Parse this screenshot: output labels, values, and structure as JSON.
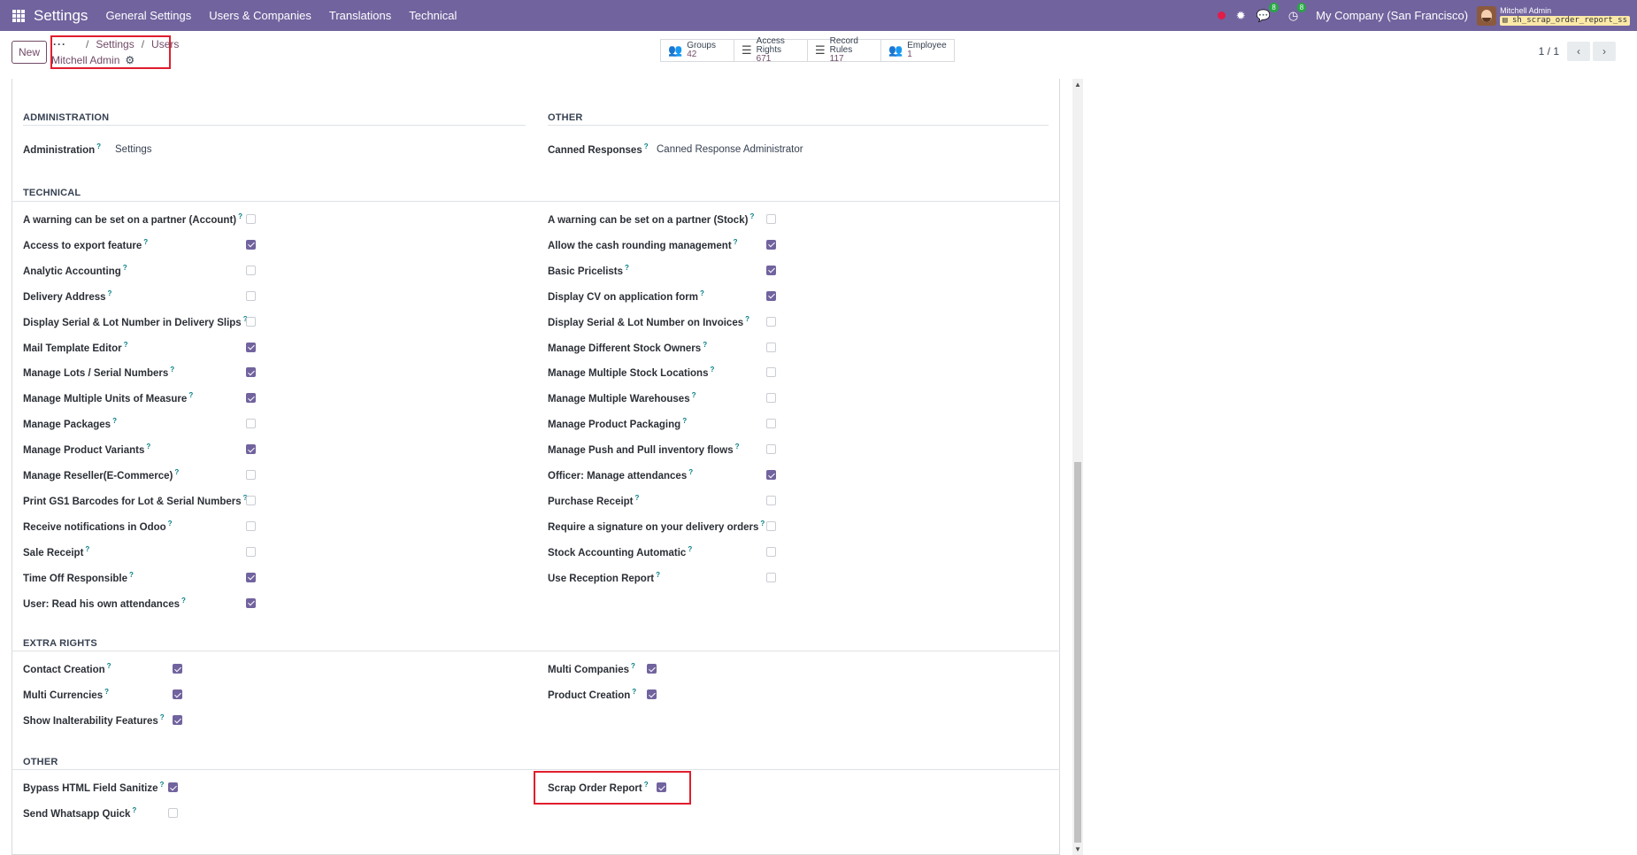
{
  "navbar": {
    "brand": "Settings",
    "menu": [
      "General Settings",
      "Users & Companies",
      "Translations",
      "Technical"
    ],
    "chat_badge": "8",
    "activity_badge": "8",
    "company": "My Company (San Francisco)",
    "user_name": "Mitchell Admin",
    "db_name": "sh_scrap_order_report_ss",
    "accent_color": "#71639e"
  },
  "control": {
    "new_label": "New",
    "breadcrumb": [
      "Settings",
      "Users"
    ],
    "record_title": "Mitchell Admin",
    "smart_buttons": [
      {
        "label": "Groups",
        "count": "42",
        "icon": "users-icon"
      },
      {
        "label": "Access Rights",
        "count": "671",
        "icon": "list-icon"
      },
      {
        "label": "Record Rules",
        "count": "117",
        "icon": "list-icon"
      },
      {
        "label": "Employee",
        "count": "1",
        "icon": "users-icon"
      }
    ],
    "pager": "1 / 1"
  },
  "form": {
    "administration": {
      "title": "ADMINISTRATION",
      "label": "Administration",
      "value": "Settings"
    },
    "other_top": {
      "title": "OTHER",
      "label": "Canned Responses",
      "value": "Canned Response Administrator"
    },
    "technical": {
      "title": "TECHNICAL",
      "left": [
        {
          "label": "A warning can be set on a partner (Account)",
          "checked": false
        },
        {
          "label": "Access to export feature",
          "checked": true
        },
        {
          "label": "Analytic Accounting",
          "checked": false
        },
        {
          "label": "Delivery Address",
          "checked": false
        },
        {
          "label": "Display Serial & Lot Number in Delivery Slips",
          "checked": false
        },
        {
          "label": "Mail Template Editor",
          "checked": true
        },
        {
          "label": "Manage Lots / Serial Numbers",
          "checked": true
        },
        {
          "label": "Manage Multiple Units of Measure",
          "checked": true
        },
        {
          "label": "Manage Packages",
          "checked": false
        },
        {
          "label": "Manage Product Variants",
          "checked": true
        },
        {
          "label": "Manage Reseller(E-Commerce)",
          "checked": false
        },
        {
          "label": "Print GS1 Barcodes for Lot & Serial Numbers",
          "checked": false
        },
        {
          "label": "Receive notifications in Odoo",
          "checked": false
        },
        {
          "label": "Sale Receipt",
          "checked": false
        },
        {
          "label": "Time Off Responsible",
          "checked": true
        },
        {
          "label": "User: Read his own attendances",
          "checked": true
        }
      ],
      "right": [
        {
          "label": "A warning can be set on a partner (Stock)",
          "checked": false
        },
        {
          "label": "Allow the cash rounding management",
          "checked": true
        },
        {
          "label": "Basic Pricelists",
          "checked": true
        },
        {
          "label": "Display CV on application form",
          "checked": true
        },
        {
          "label": "Display Serial & Lot Number on Invoices",
          "checked": false
        },
        {
          "label": "Manage Different Stock Owners",
          "checked": false
        },
        {
          "label": "Manage Multiple Stock Locations",
          "checked": false
        },
        {
          "label": "Manage Multiple Warehouses",
          "checked": false
        },
        {
          "label": "Manage Product Packaging",
          "checked": false
        },
        {
          "label": "Manage Push and Pull inventory flows",
          "checked": false
        },
        {
          "label": "Officer: Manage attendances",
          "checked": true
        },
        {
          "label": "Purchase Receipt",
          "checked": false
        },
        {
          "label": "Require a signature on your delivery orders",
          "checked": false
        },
        {
          "label": "Stock Accounting Automatic",
          "checked": false
        },
        {
          "label": "Use Reception Report",
          "checked": false
        }
      ]
    },
    "extra_rights": {
      "title": "EXTRA RIGHTS",
      "left": [
        {
          "label": "Contact Creation",
          "checked": true
        },
        {
          "label": "Multi Currencies",
          "checked": true
        },
        {
          "label": "Show Inalterability Features",
          "checked": true
        }
      ],
      "right": [
        {
          "label": "Multi Companies",
          "checked": true
        },
        {
          "label": "Product Creation",
          "checked": true
        }
      ]
    },
    "other_bottom": {
      "title": "OTHER",
      "left": [
        {
          "label": "Bypass HTML Field Sanitize",
          "checked": true
        },
        {
          "label": "Send Whatsapp Quick",
          "checked": false
        }
      ],
      "right": [
        {
          "label": "Scrap Order Report",
          "checked": true
        }
      ]
    }
  }
}
